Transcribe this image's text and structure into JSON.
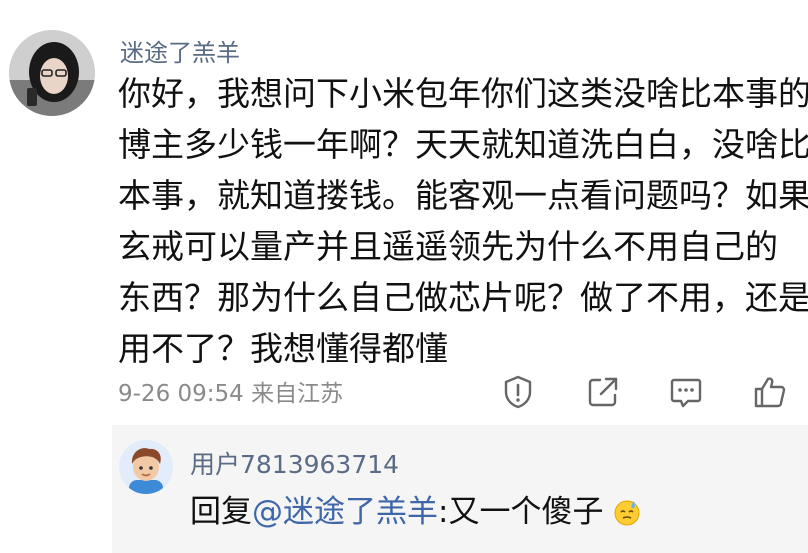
{
  "comment": {
    "username": "迷途了羔羊",
    "lines": [
      "你好，我想问下小米包年你们这类没啥比本事的",
      "博主多少钱一年啊？天天就知道洗白白，没啥比",
      "本事，就知道搂钱。能客观一点看问题吗？如果",
      "玄戒可以量产并且遥遥领先为什么不用自己的",
      "东西？那为什么自己做芯片呢？做了不用，还是",
      "用不了？我想懂得都懂"
    ],
    "meta": "9-26 09:54 来自江苏",
    "actions": [
      "alert-icon",
      "share-icon",
      "comment-icon",
      "like-icon"
    ]
  },
  "reply": {
    "username": "用户7813963714",
    "prefix": "回复",
    "mention": "@迷途了羔羊",
    "text": ":又一个傻子",
    "emoji": "sweat-emoji"
  }
}
